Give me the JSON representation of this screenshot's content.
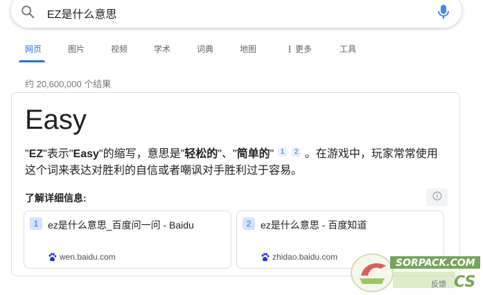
{
  "search": {
    "query": "EZ是什么意思"
  },
  "tabs": [
    {
      "label": "网页"
    },
    {
      "label": "图片"
    },
    {
      "label": "视频"
    },
    {
      "label": "学术"
    },
    {
      "label": "词典"
    },
    {
      "label": "地图"
    },
    {
      "label": "更多"
    },
    {
      "label": "工具"
    }
  ],
  "result_stats": "约 20,600,000 个结果",
  "answer": {
    "title": "Easy",
    "q1": "\"",
    "ez": "EZ",
    "q2": "\"表示\"",
    "easy": "Easy",
    "mid": "\"的缩写，意思是\"",
    "easygoing": "轻松的",
    "sep": "\"、\"",
    "simple": "简单的",
    "q3": "\"",
    "cite1": "1",
    "cite2": "2",
    "tail": "。在游戏中，玩家常常使用这个词来表达对胜利的自信或者嘲讽对手胜利过于容易。"
  },
  "learn_more": "了解详细信息:",
  "sources": [
    {
      "num": "1",
      "title": "ez是什么意思_百度问一问 - Baidu",
      "domain": "wen.baidu.com"
    },
    {
      "num": "2",
      "title": "ez是什么意思 - 百度知道",
      "domain": "zhidao.baidu.com"
    }
  ],
  "feedback": "反馈",
  "watermark": {
    "top": "SORPACK.COM",
    "bottom": "CS"
  },
  "colors": {
    "accent": "#1a73e8",
    "cite_bg": "#e8f0fe",
    "num_bg": "#d2e3fc",
    "border": "#dadce0"
  }
}
